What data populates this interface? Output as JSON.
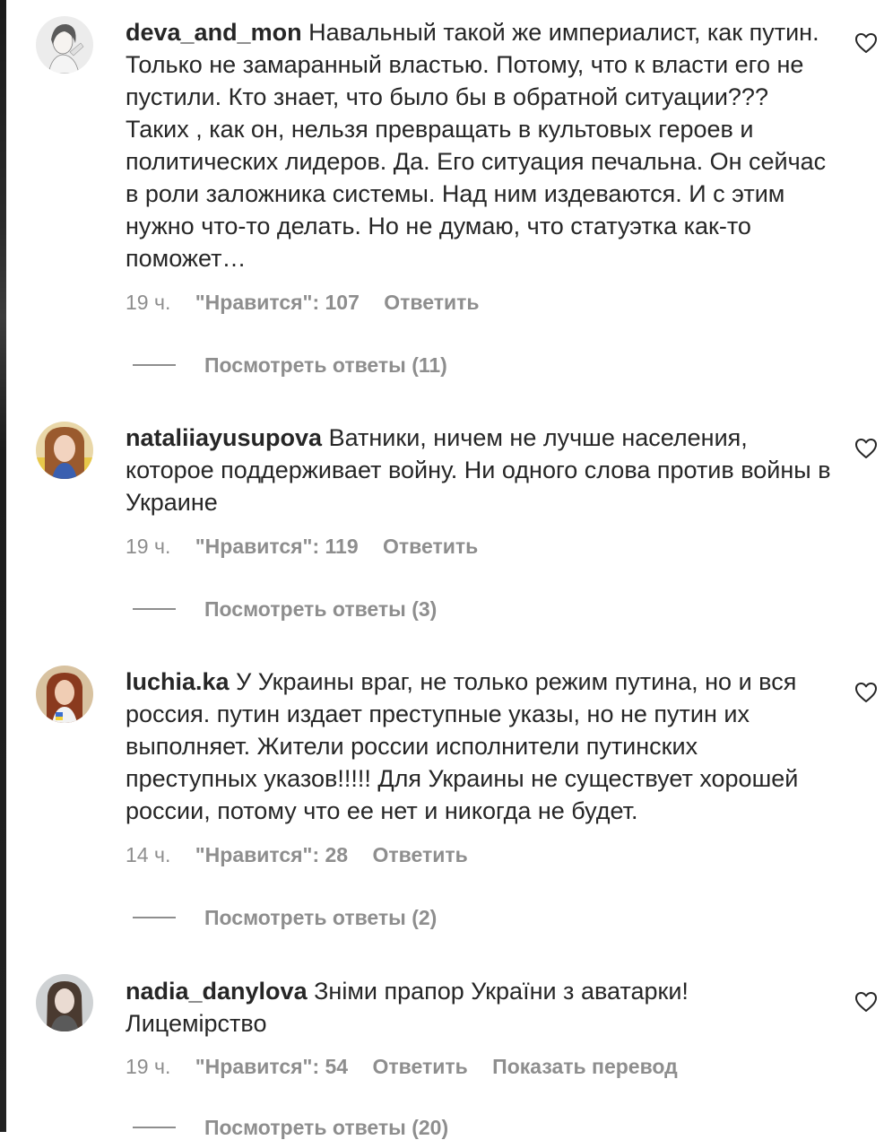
{
  "comments": [
    {
      "username": "deva_and_mon",
      "text": "Навальный такой же империалист, как путин. Только не замаранный властью. Потому, что к власти его не пустили. Кто знает, что было бы в обратной ситуации??? Таких , как он, нельзя превращать в культовых героев и политических лидеров. Да. Его ситуация печальна. Он сейчас в роли заложника системы. Над ним издеваются. И с этим нужно что-то делать. Но не думаю, что статуэтка как-то поможет…",
      "time": "19 ч.",
      "likes": "\"Нравится\": 107",
      "reply": "Ответить",
      "view_replies": "Посмотреть ответы (11)"
    },
    {
      "username": "nataliiayusupova",
      "text": "Ватники, ничем не лучше населения, которое поддерживает войну. Ни одного слова против войны в Украине",
      "time": "19 ч.",
      "likes": "\"Нравится\": 119",
      "reply": "Ответить",
      "view_replies": "Посмотреть ответы (3)"
    },
    {
      "username": "luchia.ka",
      "text": "У Украины враг, не только режим путина, но и вся россия. путин издает преступные указы, но не путин их выполняет. Жители россии исполнители путинских преступных указов!!!!! Для Украины не существует хорошей россии, потому что ее нет и никогда не будет.",
      "time": "14 ч.",
      "likes": "\"Нравится\": 28",
      "reply": "Ответить",
      "view_replies": "Посмотреть ответы (2)"
    },
    {
      "username": "nadia_danylova",
      "text": "Зніми прапор України з аватарки! Лицемірство",
      "time": "19 ч.",
      "likes": "\"Нравится\": 54",
      "reply": "Ответить",
      "translate": "Показать перевод",
      "view_replies": "Посмотреть ответы (20)"
    }
  ],
  "icons": {
    "like": "heart-outline-icon"
  },
  "colors": {
    "text": "#262626",
    "secondary": "#8e8e8e"
  }
}
